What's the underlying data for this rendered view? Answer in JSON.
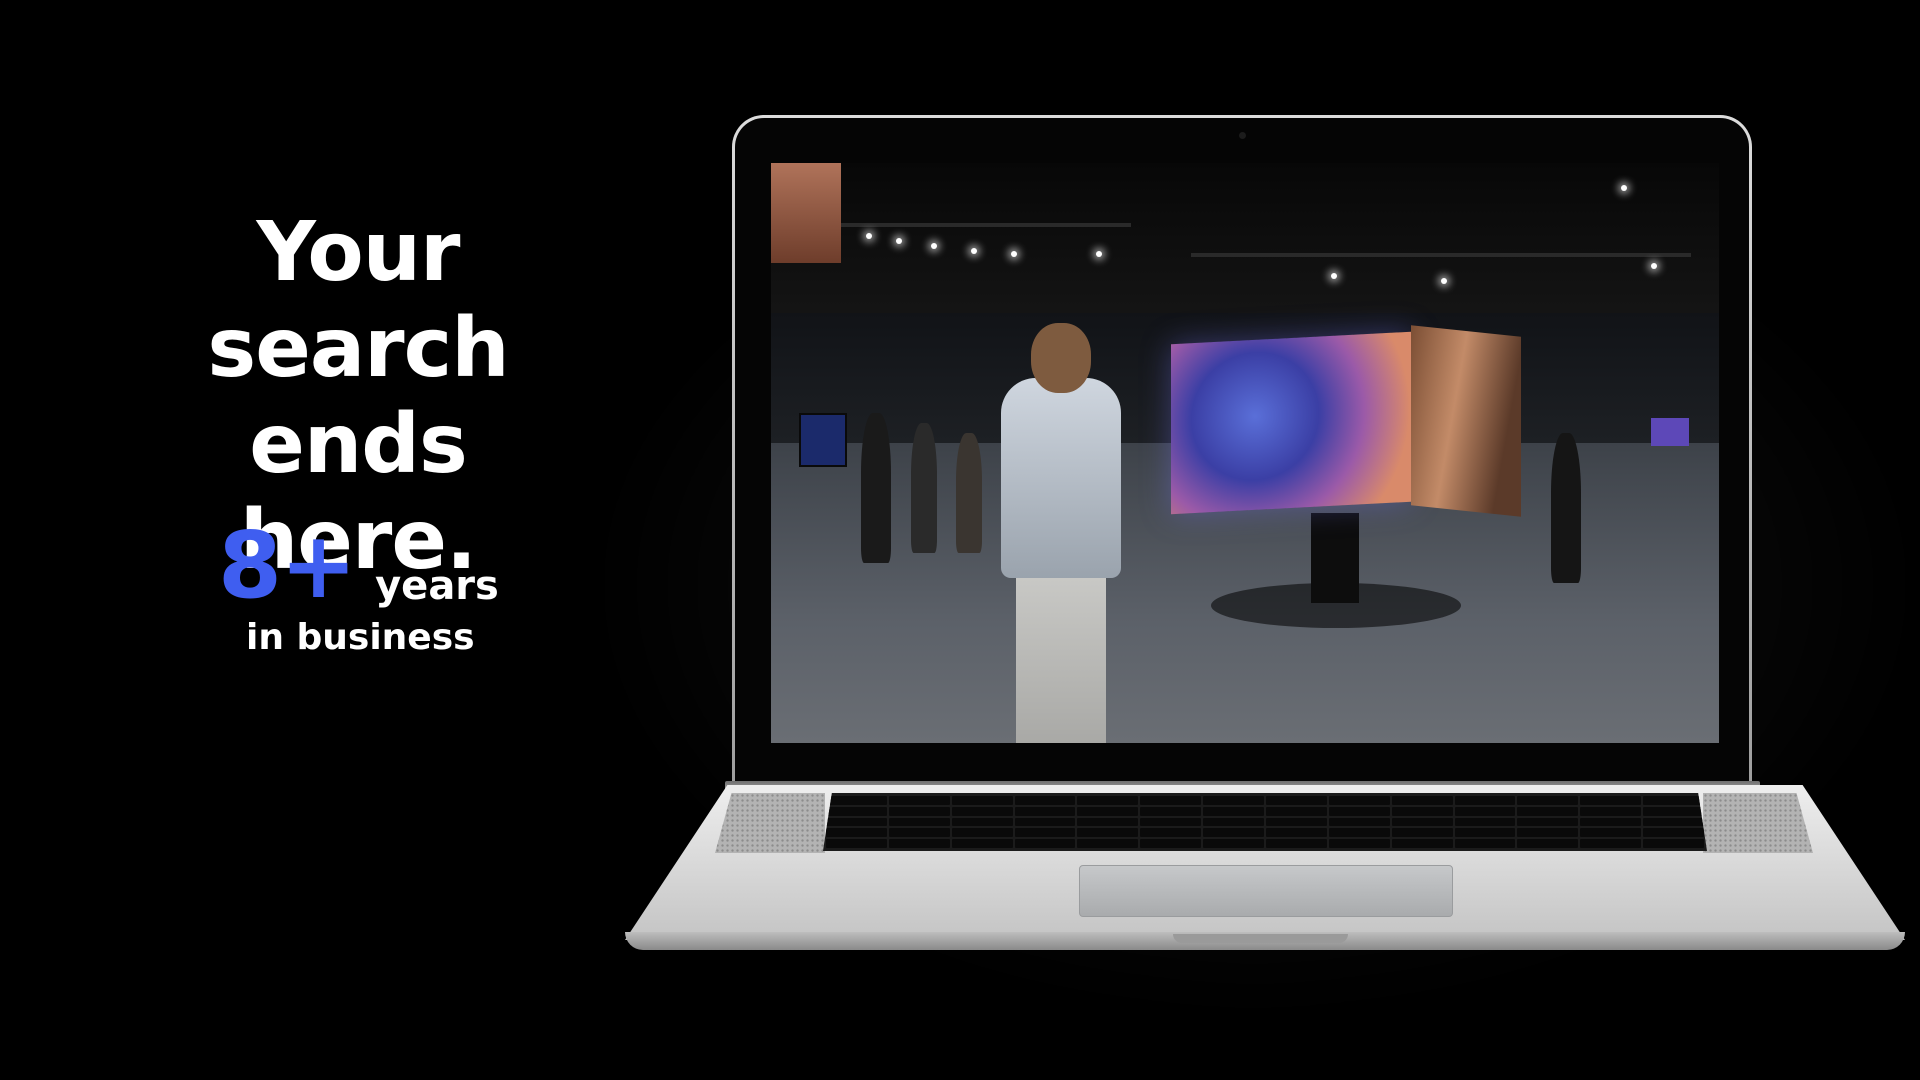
{
  "hero": {
    "headline_line1": "Your search",
    "headline_line2": "ends here."
  },
  "stat": {
    "number": "8+",
    "unit": "years",
    "caption": "in business"
  },
  "colors": {
    "background": "#000000",
    "text": "#ffffff",
    "accent": "#3f5ef0"
  },
  "laptop": {
    "screen_content": "exhibition-video"
  }
}
